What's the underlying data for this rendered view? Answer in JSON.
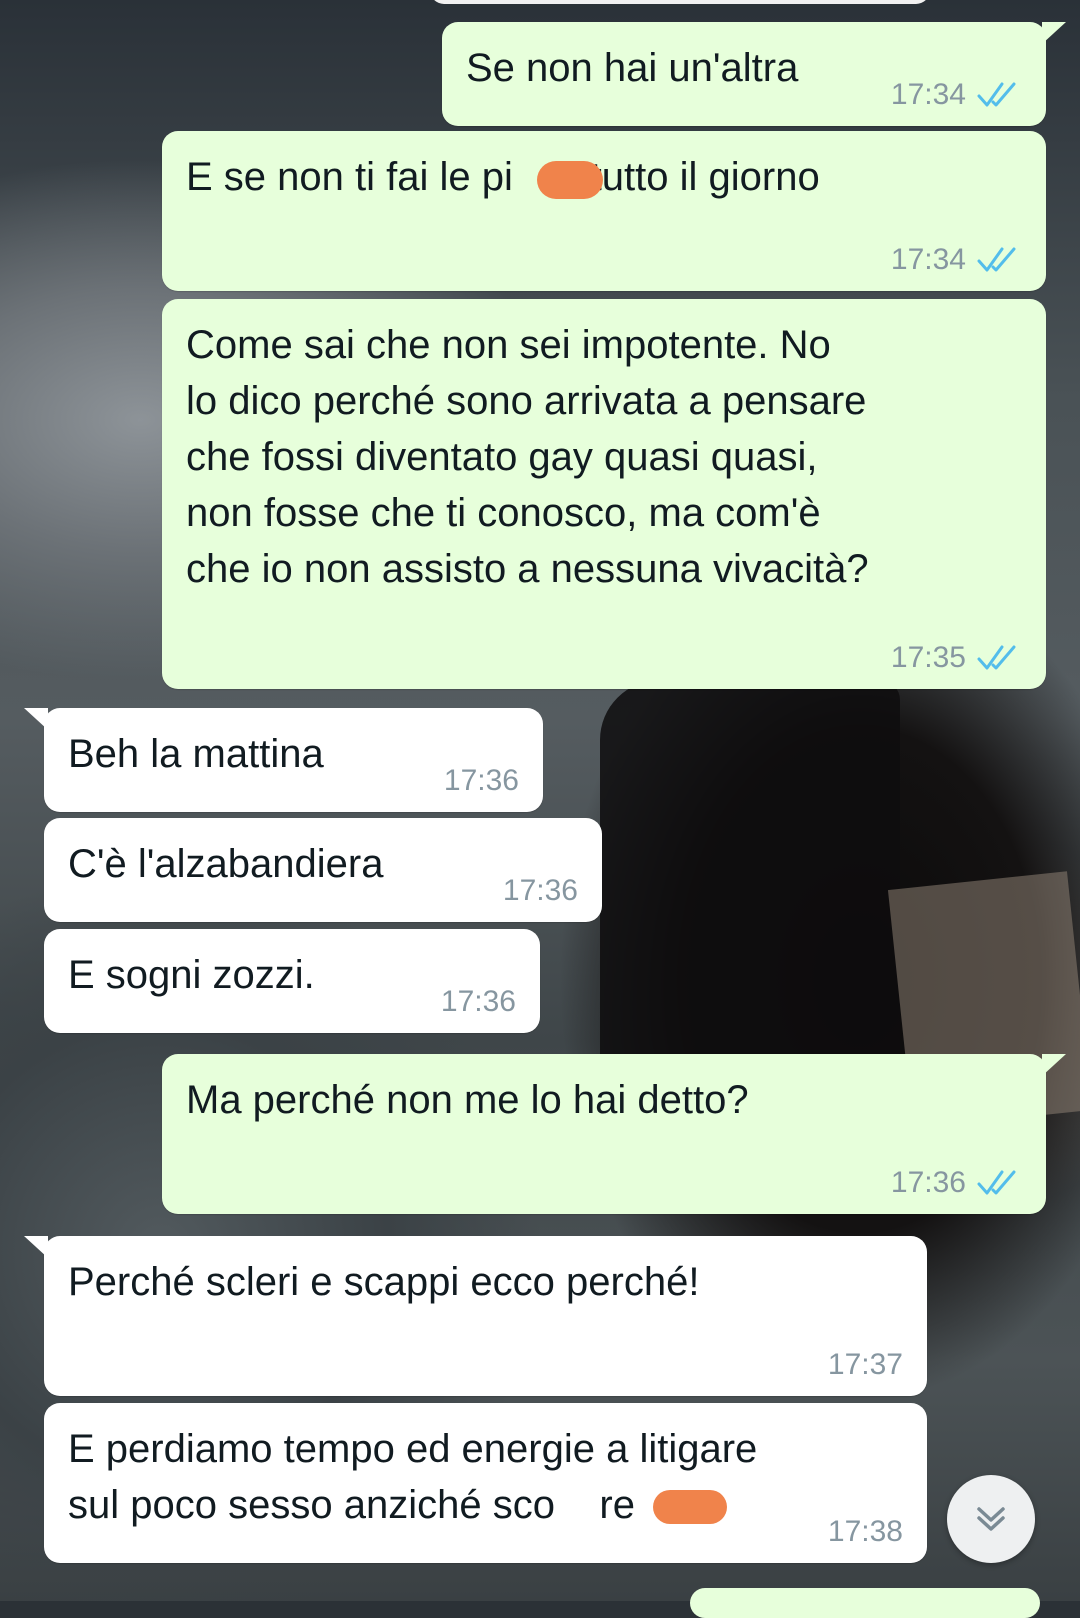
{
  "chat": {
    "messages": [
      {
        "direction": "outgoing",
        "text": "Se non hai un'altra",
        "time": "17:34",
        "status": "read"
      },
      {
        "direction": "outgoing",
        "text": "E se non ti fai le pi    e tutto il giorno",
        "time": "17:34",
        "status": "read"
      },
      {
        "direction": "outgoing",
        "text": "Come sai che non sei impotente. No\nlo dico perché sono arrivata a pensare\nche fossi diventato gay quasi quasi,\nnon fosse che ti conosco, ma com'è\nche io non assisto a nessuna vivacità?",
        "time": "17:35",
        "status": "read"
      },
      {
        "direction": "incoming",
        "text": "Beh la mattina",
        "time": "17:36"
      },
      {
        "direction": "incoming",
        "text": "C'è l'alzabandiera",
        "time": "17:36"
      },
      {
        "direction": "incoming",
        "text": "E sogni zozzi.",
        "time": "17:36"
      },
      {
        "direction": "outgoing",
        "text": "Ma perché non me lo hai detto?",
        "time": "17:36",
        "status": "read"
      },
      {
        "direction": "incoming",
        "text": "Perché scleri e scappi ecco perché!",
        "time": "17:37"
      },
      {
        "direction": "incoming",
        "text": "E perdiamo tempo ed energie a litigare\nsul poco sesso anziché sco    re",
        "time": "17:38"
      }
    ]
  },
  "colors": {
    "outgoing_bubble": "#e7ffdb",
    "incoming_bubble": "#ffffff",
    "read_ticks": "#53bdeb",
    "timestamp": "#8696a0",
    "redaction": "#f0834b"
  },
  "icons": {
    "read_receipt": "double-check-icon",
    "scroll_down": "chevron-double-down-icon"
  }
}
